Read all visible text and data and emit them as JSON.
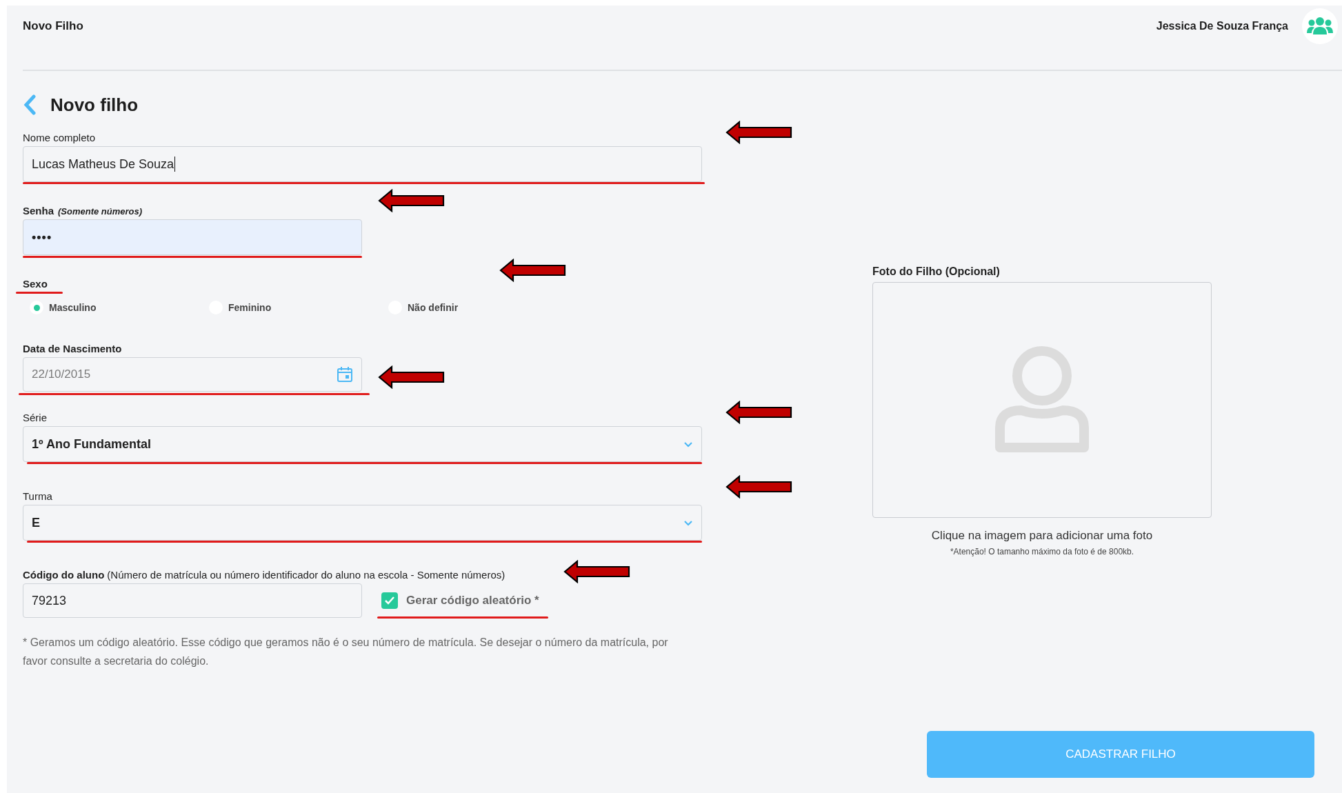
{
  "header": {
    "title": "Novo Filho",
    "user_name": "Jessica De Souza França"
  },
  "page_title": "Novo filho",
  "fields": [
    {
      "kind": "text",
      "label": "Nome completo",
      "label_bold": false,
      "value": "Lucas Matheus De Souza",
      "focused": true,
      "annotated": true
    },
    {
      "kind": "password",
      "label": "Senha",
      "label_bold": true,
      "hint": "(Somente números)",
      "value": "••••",
      "annotated": true
    },
    {
      "kind": "radio",
      "label": "Sexo",
      "label_bold": true,
      "annotated": true,
      "options": [
        {
          "label": "Masculino",
          "selected": true
        },
        {
          "label": "Feminino",
          "selected": false
        },
        {
          "label": "Não definir",
          "selected": false
        }
      ]
    },
    {
      "kind": "date",
      "label": "Data de Nascimento",
      "label_bold": true,
      "value": "22/10/2015",
      "annotated": true
    },
    {
      "kind": "select",
      "label": "Série",
      "label_bold": false,
      "value": "1º Ano Fundamental",
      "annotated": true
    },
    {
      "kind": "select",
      "label": "Turma",
      "label_bold": false,
      "value": "E",
      "annotated": true
    },
    {
      "kind": "code",
      "label": "Código do aluno",
      "label_bold": true,
      "hint": "(Número de matrícula ou número identificador do aluno na escola - Somente números)",
      "value": "79213",
      "annotated": true,
      "checkbox": {
        "label": "Gerar código aleatório *",
        "checked": true
      }
    }
  ],
  "footnote": "* Geramos um código aleatório. Esse código que geramos não é o seu número de matrícula. Se desejar o número da matrícula, por favor consulte a secretaria do colégio.",
  "photo": {
    "label": "Foto do Filho (Opcional)",
    "caption": "Clique na imagem para adicionar uma foto",
    "note": "*Atenção! O tamanho máximo da foto é de 800kb."
  },
  "submit": "CADASTRAR FILHO"
}
